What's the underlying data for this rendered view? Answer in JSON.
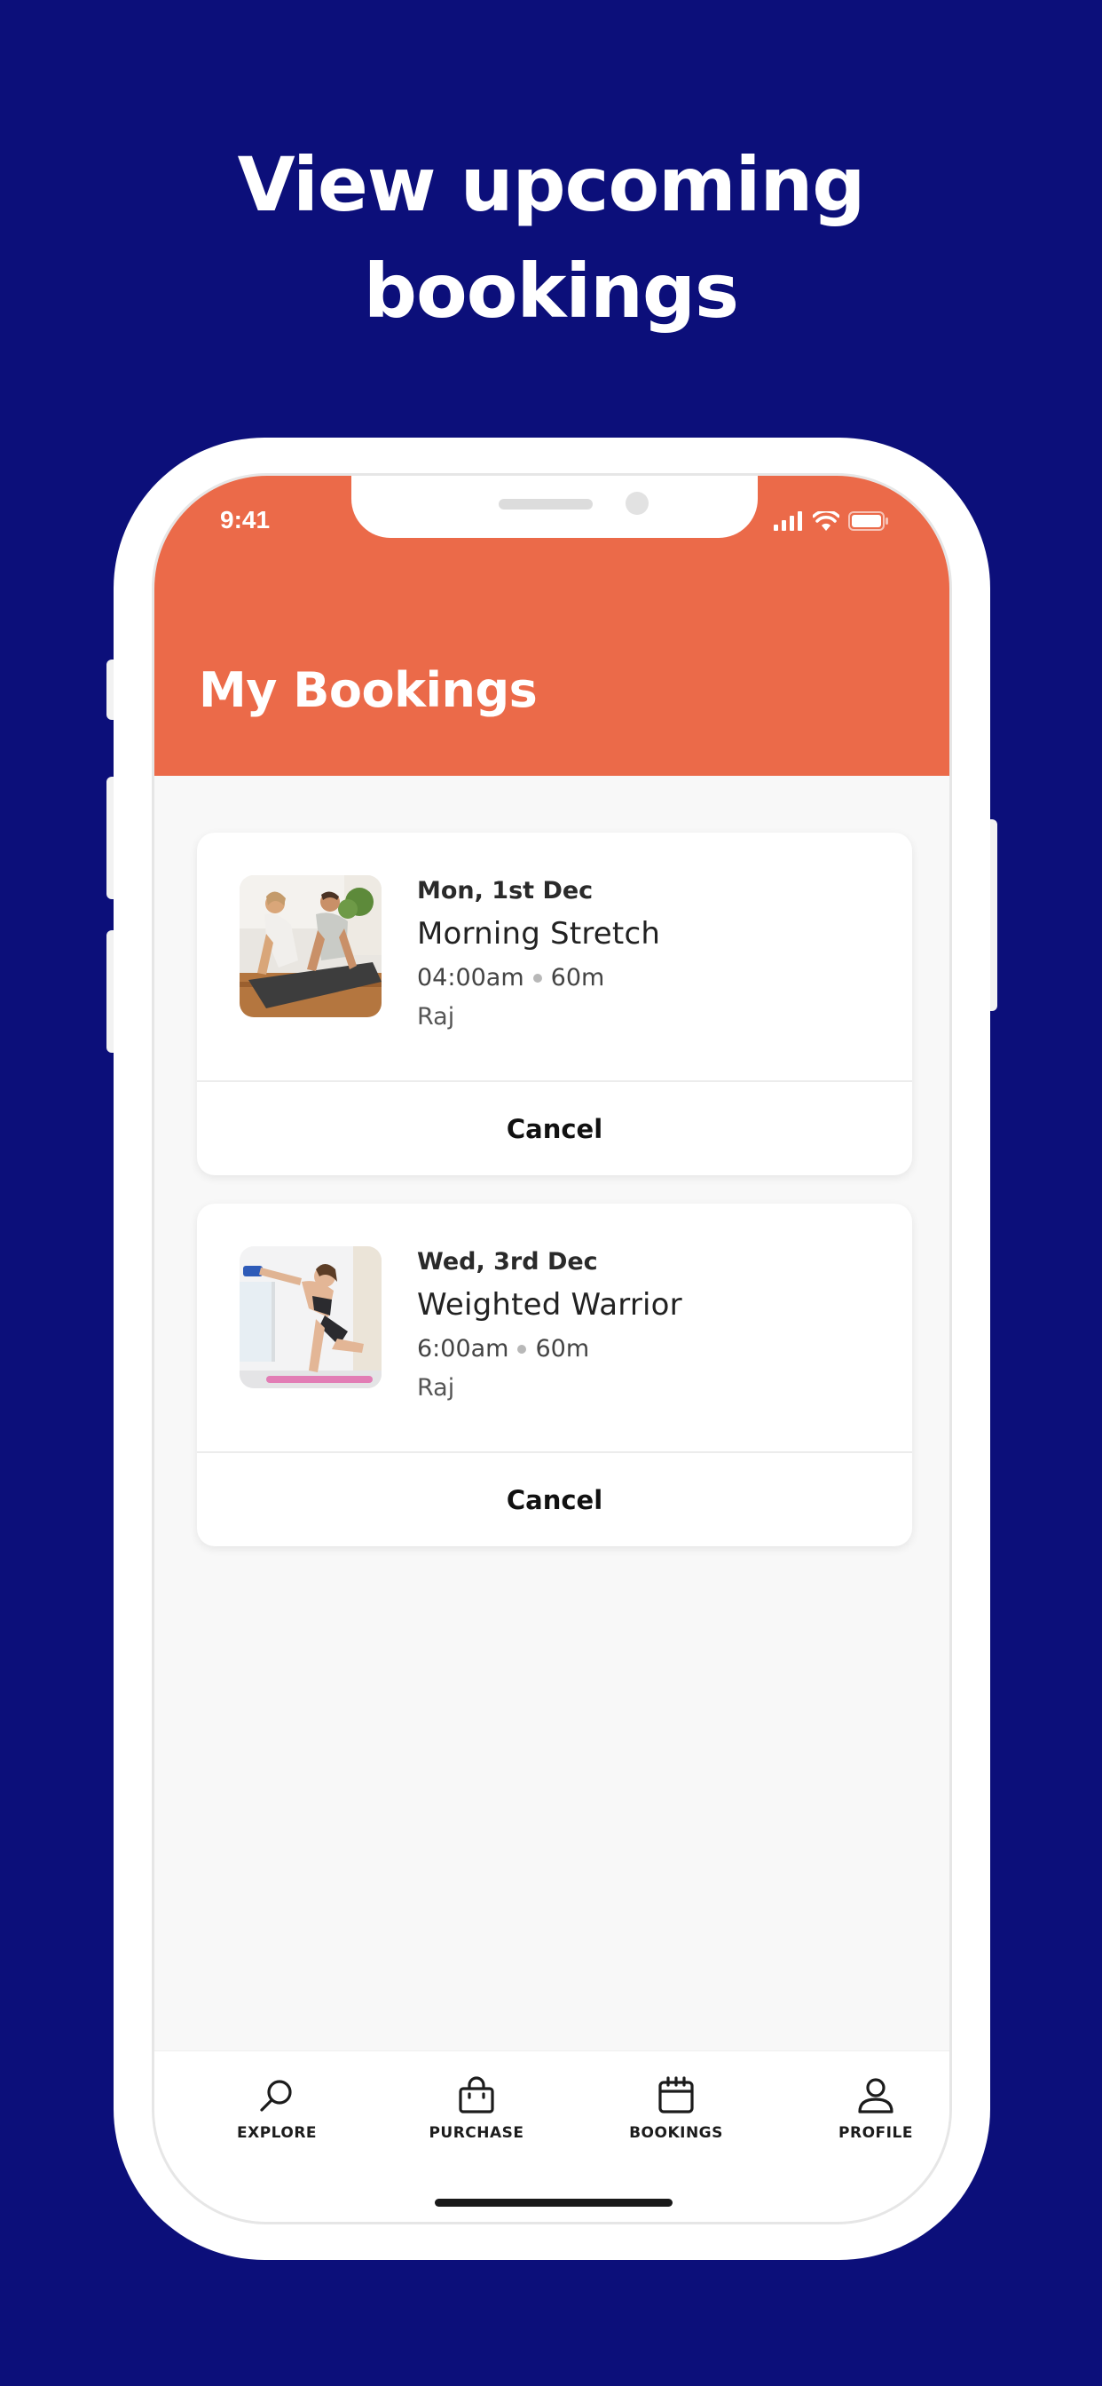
{
  "promo": {
    "headline_line1": "View upcoming",
    "headline_line2": "bookings"
  },
  "status_bar": {
    "time": "9:41",
    "icons": [
      "signal-icon",
      "wifi-icon",
      "battery-icon"
    ]
  },
  "header": {
    "title": "My Bookings",
    "color": "#eb6a49"
  },
  "bookings": [
    {
      "date": "Mon, 1st Dec",
      "class_name": "Morning Stretch",
      "time": "04:00am",
      "duration": "60m",
      "instructor": "Raj",
      "action": "Cancel",
      "image": "two-people-stretching-photo"
    },
    {
      "date": "Wed, 3rd Dec",
      "class_name": "Weighted Warrior",
      "time": "6:00am",
      "duration": "60m",
      "instructor": "Raj",
      "action": "Cancel",
      "image": "woman-with-dumbbell-photo"
    }
  ],
  "tabbar": {
    "items": [
      {
        "label": "EXPLORE",
        "icon": "search-icon"
      },
      {
        "label": "PURCHASE",
        "icon": "shopping-bag-icon"
      },
      {
        "label": "BOOKINGS",
        "icon": "calendar-icon"
      },
      {
        "label": "PROFILE",
        "icon": "user-icon"
      }
    ]
  },
  "colors": {
    "background": "#0c0f7a",
    "accent": "#eb6a49",
    "surface": "#f8f8f8"
  }
}
